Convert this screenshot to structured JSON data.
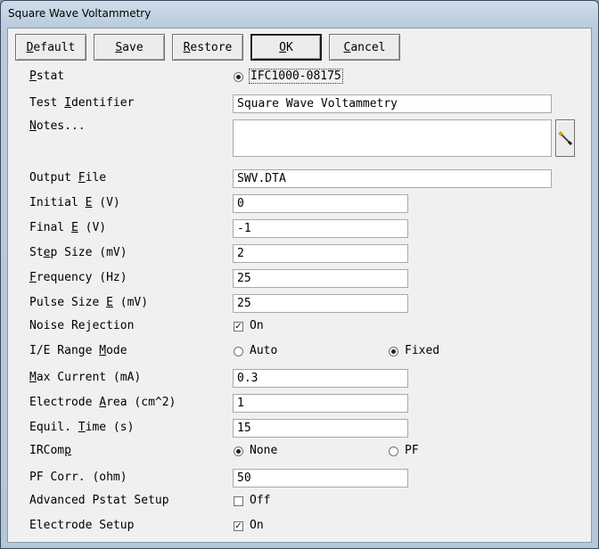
{
  "window": {
    "title": "Square Wave Voltammetry"
  },
  "toolbar": {
    "default": {
      "u": "D",
      "rest": "efault"
    },
    "save": {
      "u": "S",
      "rest": "ave"
    },
    "restore": {
      "u": "R",
      "rest": "estore"
    },
    "ok": {
      "u": "O",
      "rest": "K"
    },
    "cancel": {
      "u": "C",
      "rest": "ancel"
    }
  },
  "labels": {
    "pstat": {
      "pre": "",
      "u": "P",
      "post": "stat"
    },
    "test_identifier": {
      "pre": "Test ",
      "u": "I",
      "post": "dentifier"
    },
    "notes": {
      "pre": "",
      "u": "N",
      "post": "otes..."
    },
    "output_file": {
      "pre": "Output ",
      "u": "F",
      "post": "ile"
    },
    "initial_e": {
      "pre": "Initial ",
      "u": "E",
      "post": " (V)"
    },
    "final_e": {
      "pre": "Final ",
      "u": "E",
      "post": " (V)"
    },
    "step_size": {
      "pre": "St",
      "u": "e",
      "post": "p Size (mV)"
    },
    "frequency": {
      "pre": "",
      "u": "F",
      "post": "requency (Hz)"
    },
    "pulse_size": {
      "pre": "Pulse Size ",
      "u": "E",
      "post": " (mV)"
    },
    "noise_rejection": {
      "pre": "Noise Rejection",
      "u": "",
      "post": ""
    },
    "ie_range_mode": {
      "pre": "I/E Range ",
      "u": "M",
      "post": "ode"
    },
    "max_current": {
      "pre": "",
      "u": "M",
      "post": "ax Current (mA)"
    },
    "electrode_area": {
      "pre": "Electrode ",
      "u": "A",
      "post": "rea (cm^2)"
    },
    "equil_time": {
      "pre": "Equil. ",
      "u": "T",
      "post": "ime (s)"
    },
    "ircomp": {
      "pre": "IRCom",
      "u": "p",
      "post": ""
    },
    "pf_corr": {
      "pre": "PF Corr. (ohm)",
      "u": "",
      "post": ""
    },
    "advanced_pstat": {
      "pre": "Advanced Pstat Setup",
      "u": "",
      "post": ""
    },
    "electrode_setup": {
      "pre": "Electrode Setup",
      "u": "",
      "post": ""
    }
  },
  "pstat": {
    "value": "IFC1000-08175",
    "selected": true
  },
  "fields": {
    "test_identifier": "Square Wave Voltammetry",
    "notes": "",
    "output_file": "SWV.DTA",
    "initial_e": "0",
    "final_e": "-1",
    "step_size": "2",
    "frequency": "25",
    "pulse_size": "25",
    "max_current": "0.3",
    "electrode_area": "1",
    "equil_time": "15",
    "pf_corr": "50"
  },
  "noise_rejection": {
    "label": "On",
    "checked": true
  },
  "ie_range_mode": {
    "options": [
      "Auto",
      "Fixed"
    ],
    "selected": "Fixed"
  },
  "ircomp": {
    "options": [
      "None",
      "PF"
    ],
    "selected": "None"
  },
  "advanced_pstat": {
    "label": "Off",
    "checked": false
  },
  "electrode_setup": {
    "label": "On",
    "checked": true
  },
  "icons": {
    "notes_edit": "edit-pen-icon"
  }
}
